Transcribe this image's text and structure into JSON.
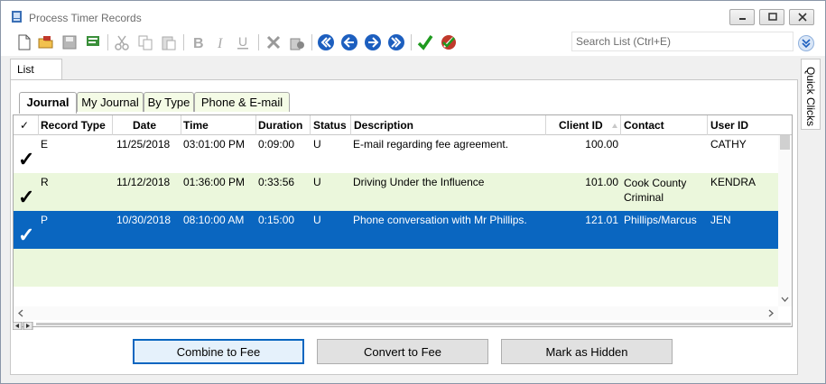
{
  "window": {
    "title": "Process Timer Records"
  },
  "toolbar": {
    "icons": [
      "new-document-icon",
      "open-folder-icon",
      "save-icon",
      "notes-icon",
      "cut-icon",
      "copy-icon",
      "paste-icon",
      "bold-icon",
      "italic-icon",
      "underline-icon",
      "delete-icon",
      "archive-icon",
      "first-record-icon",
      "previous-record-icon",
      "next-record-icon",
      "last-record-icon",
      "approve-check-icon",
      "disable-icon"
    ],
    "search_placeholder": "Search List (Ctrl+E)"
  },
  "outer_tab": {
    "label": "List"
  },
  "quick_clicks": {
    "label": "Quick Clicks"
  },
  "tabs": [
    {
      "label": "Journal",
      "active": true
    },
    {
      "label": "My Journal",
      "active": false
    },
    {
      "label": "By Type",
      "active": false
    },
    {
      "label": "Phone & E-mail",
      "active": false
    }
  ],
  "grid": {
    "columns": [
      "Record Type",
      "Date",
      "Time",
      "Duration",
      "Status",
      "Description",
      "Client ID",
      "Contact",
      "User ID"
    ],
    "check_header": "✓",
    "rows": [
      {
        "check": "✓",
        "type": "E",
        "date": "11/25/2018",
        "time": "03:01:00 PM",
        "duration": "0:09:00",
        "status": "U",
        "description": "E-mail regarding fee agreement.",
        "client_id": "100.00",
        "contact": "",
        "user_id": "CATHY"
      },
      {
        "check": "✓",
        "type": "R",
        "date": "11/12/2018",
        "time": "01:36:00 PM",
        "duration": "0:33:56",
        "status": "U",
        "description": "Driving Under the Influence",
        "client_id": "101.00",
        "contact": "Cook County Criminal",
        "user_id": "KENDRA"
      },
      {
        "check": "✓",
        "type": "P",
        "date": "10/30/2018",
        "time": "08:10:00 AM",
        "duration": "0:15:00",
        "status": "U",
        "description": "Phone conversation with Mr Phillips.",
        "client_id": "121.01",
        "contact": "Phillips/Marcus",
        "user_id": "JEN"
      }
    ]
  },
  "buttons": {
    "combine": "Combine to Fee",
    "convert": "Convert to Fee",
    "hide": "Mark as Hidden"
  },
  "colors": {
    "selected_row": "#0a66c0",
    "alt_row": "#ebf7dc"
  }
}
